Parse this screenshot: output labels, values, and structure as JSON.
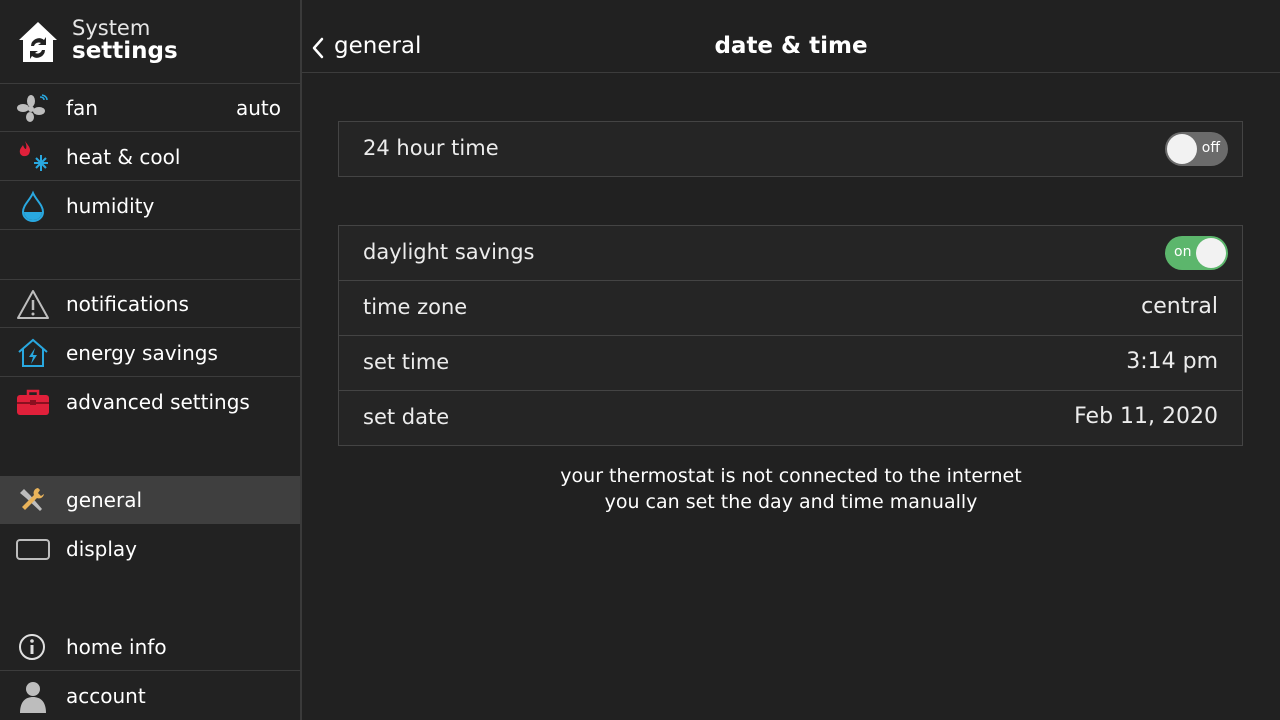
{
  "sidebar": {
    "header": {
      "line1": "System",
      "line2": "settings",
      "logo_icon": "house-logo-icon"
    },
    "items": [
      {
        "label": "fan",
        "value": "auto",
        "icon": "fan-icon"
      },
      {
        "label": "heat & cool",
        "icon": "heat-cool-icon"
      },
      {
        "label": "humidity",
        "icon": "water-drop-icon"
      },
      {
        "label": "notifications",
        "icon": "warning-icon"
      },
      {
        "label": "energy savings",
        "icon": "energy-house-icon"
      },
      {
        "label": "advanced settings",
        "icon": "toolbox-icon"
      },
      {
        "label": "general",
        "icon": "tools-icon",
        "active": true
      },
      {
        "label": "display",
        "icon": "display-icon"
      },
      {
        "label": "home info",
        "icon": "info-icon"
      },
      {
        "label": "account",
        "icon": "person-icon"
      }
    ]
  },
  "header": {
    "back_label": "general",
    "title": "date & time"
  },
  "settings": {
    "hour24": {
      "label": "24 hour time",
      "state": "off"
    },
    "daylight": {
      "label": "daylight savings",
      "state": "on"
    },
    "timezone": {
      "label": "time zone",
      "value": "central"
    },
    "time": {
      "label": "set time",
      "value": "3:14 pm"
    },
    "date": {
      "label": "set date",
      "value": "Feb 11, 2020"
    }
  },
  "note": {
    "line1": "your thermostat is not connected to the internet",
    "line2": "you can set the day and time manually"
  },
  "colors": {
    "toggle_on": "#5cb66c",
    "toggle_off": "#6b6b6b",
    "accent_blue": "#29a8e0",
    "accent_red": "#e0203a"
  }
}
